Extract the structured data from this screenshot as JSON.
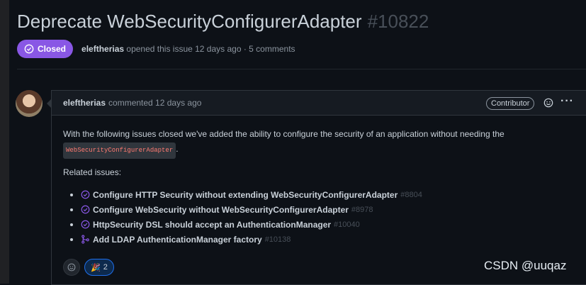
{
  "issue": {
    "title": "Deprecate WebSecurityConfigurerAdapter",
    "number": "#10822",
    "state": "Closed",
    "author": "eleftherias",
    "meta_suffix": "opened this issue 12 days ago · 5 comments"
  },
  "comment": {
    "author": "eleftherias",
    "action": "commented 12 days ago",
    "role_badge": "Contributor",
    "more_label": "···",
    "body_text": "With the following issues closed we've added the ability to configure the security of an application without needing the",
    "code_snippet": "WebSecurityConfigurerAdapter",
    "body_after_code": ".",
    "related_label": "Related issues:",
    "related": [
      {
        "title": "Configure HTTP Security without extending WebSecurityConfigurerAdapter",
        "number": "#8804",
        "icon": "closed-issue-icon"
      },
      {
        "title": "Configure WebSecurity without WebSecurityConfigurerAdapter",
        "number": "#8978",
        "icon": "closed-issue-icon"
      },
      {
        "title": "HttpSecurity DSL should accept an AuthenticationManager",
        "number": "#10040",
        "icon": "closed-issue-icon"
      },
      {
        "title": "Add LDAP AuthenticationManager factory",
        "number": "#10138",
        "icon": "merged-pr-icon"
      }
    ],
    "reaction": {
      "emoji": "🎉",
      "count": "2"
    }
  },
  "watermark": "CSDN @uuqaz",
  "colors": {
    "closed_purple": "#8957e5",
    "background": "#0d1117",
    "code_red": "#ff7b72"
  }
}
